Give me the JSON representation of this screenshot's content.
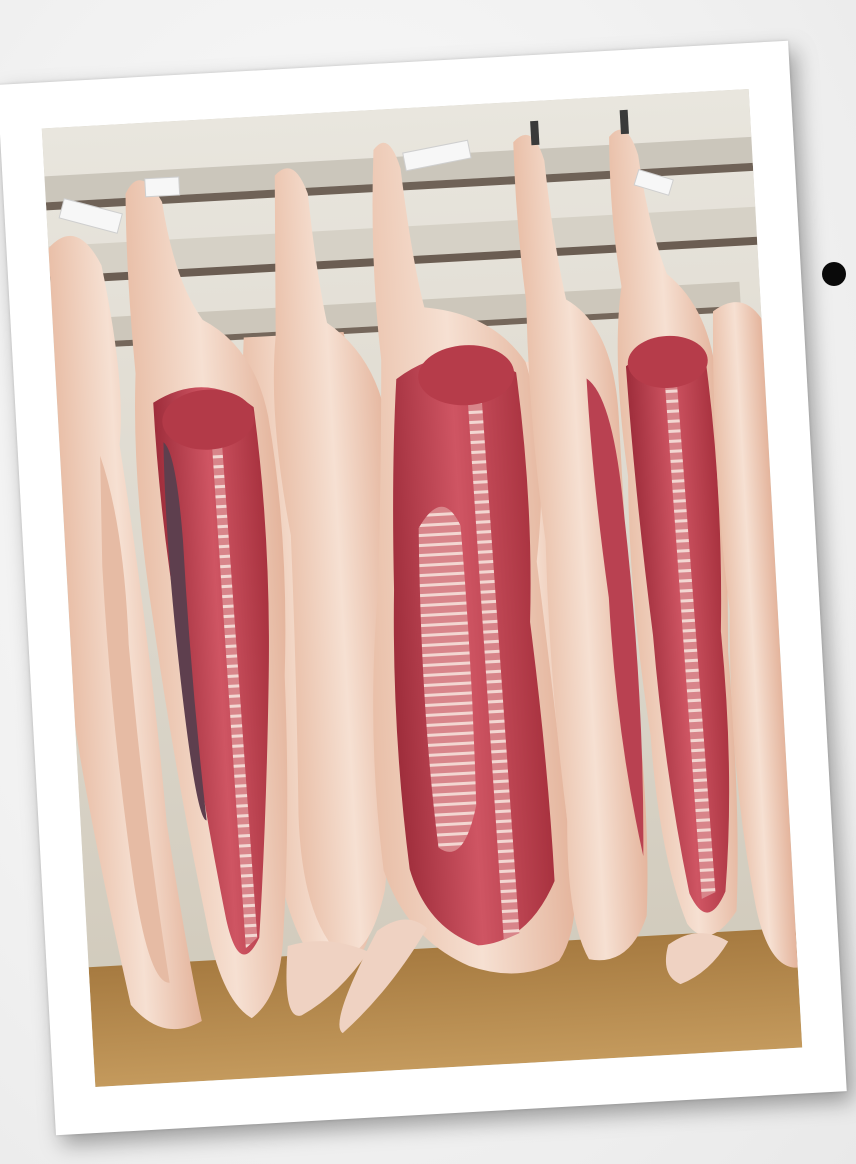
{
  "slide": {
    "bullet_text": ""
  },
  "photo": {
    "subject": "pork-carcass-halves-hanging",
    "colors": {
      "fat": "#f3d8c8",
      "fat_shade": "#e6bba4",
      "meat": "#c6404f",
      "meat_dark": "#8e2533",
      "bone": "#f0d2cc",
      "floor": "#b4894d",
      "rail": "#cfcac0"
    }
  }
}
